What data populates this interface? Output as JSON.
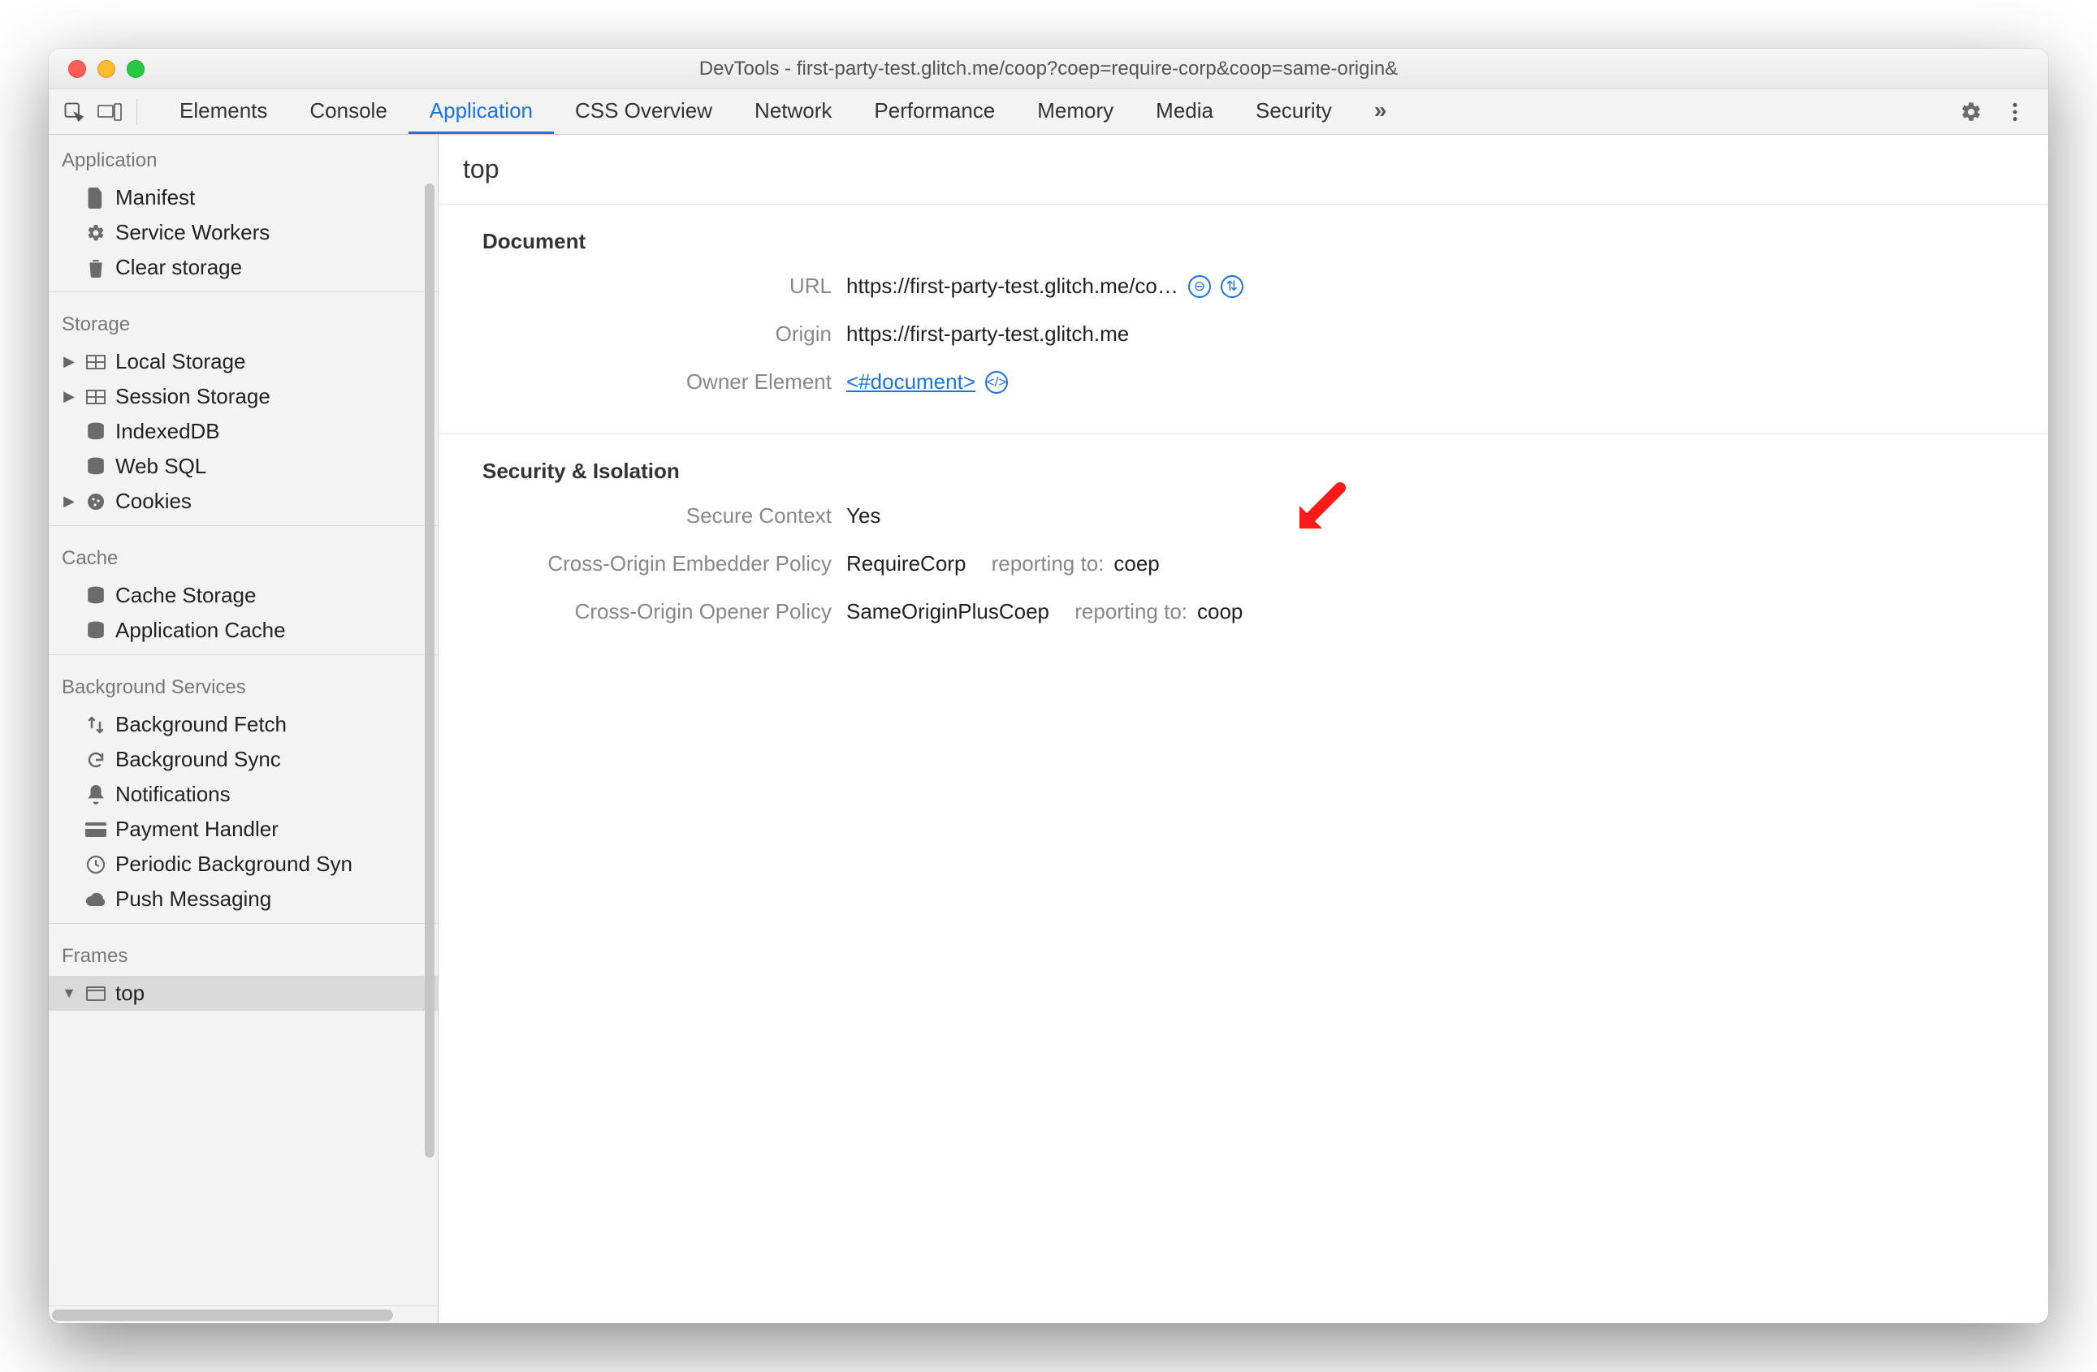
{
  "window": {
    "title": "DevTools - first-party-test.glitch.me/coop?coep=require-corp&coop=same-origin&"
  },
  "tabs": [
    {
      "label": "Elements",
      "active": false
    },
    {
      "label": "Console",
      "active": false
    },
    {
      "label": "Application",
      "active": true
    },
    {
      "label": "CSS Overview",
      "active": false
    },
    {
      "label": "Network",
      "active": false
    },
    {
      "label": "Performance",
      "active": false
    },
    {
      "label": "Memory",
      "active": false
    },
    {
      "label": "Media",
      "active": false
    },
    {
      "label": "Security",
      "active": false
    }
  ],
  "sidebar": {
    "section_application": "Application",
    "application_items": [
      {
        "label": "Manifest"
      },
      {
        "label": "Service Workers"
      },
      {
        "label": "Clear storage"
      }
    ],
    "section_storage": "Storage",
    "storage_items": [
      {
        "label": "Local Storage",
        "expandable": true
      },
      {
        "label": "Session Storage",
        "expandable": true
      },
      {
        "label": "IndexedDB"
      },
      {
        "label": "Web SQL"
      },
      {
        "label": "Cookies",
        "expandable": true
      }
    ],
    "section_cache": "Cache",
    "cache_items": [
      {
        "label": "Cache Storage"
      },
      {
        "label": "Application Cache"
      }
    ],
    "section_bg": "Background Services",
    "bg_items": [
      {
        "label": "Background Fetch"
      },
      {
        "label": "Background Sync"
      },
      {
        "label": "Notifications"
      },
      {
        "label": "Payment Handler"
      },
      {
        "label": "Periodic Background Syn"
      },
      {
        "label": "Push Messaging"
      }
    ],
    "section_frames": "Frames",
    "frames_items": [
      {
        "label": "top",
        "expandable": true,
        "expanded": true,
        "selected": true
      }
    ]
  },
  "main": {
    "title": "top",
    "document": {
      "heading": "Document",
      "url_label": "URL",
      "url_value": "https://first-party-test.glitch.me/co…",
      "origin_label": "Origin",
      "origin_value": "https://first-party-test.glitch.me",
      "owner_label": "Owner Element",
      "owner_value": "<#document>"
    },
    "security": {
      "heading": "Security & Isolation",
      "secure_context_label": "Secure Context",
      "secure_context_value": "Yes",
      "coep_label": "Cross-Origin Embedder Policy",
      "coep_value": "RequireCorp",
      "coep_reporting_prefix": "reporting to:",
      "coep_reporting_target": "coep",
      "coop_label": "Cross-Origin Opener Policy",
      "coop_value": "SameOriginPlusCoep",
      "coop_reporting_prefix": "reporting to:",
      "coop_reporting_target": "coop"
    }
  }
}
